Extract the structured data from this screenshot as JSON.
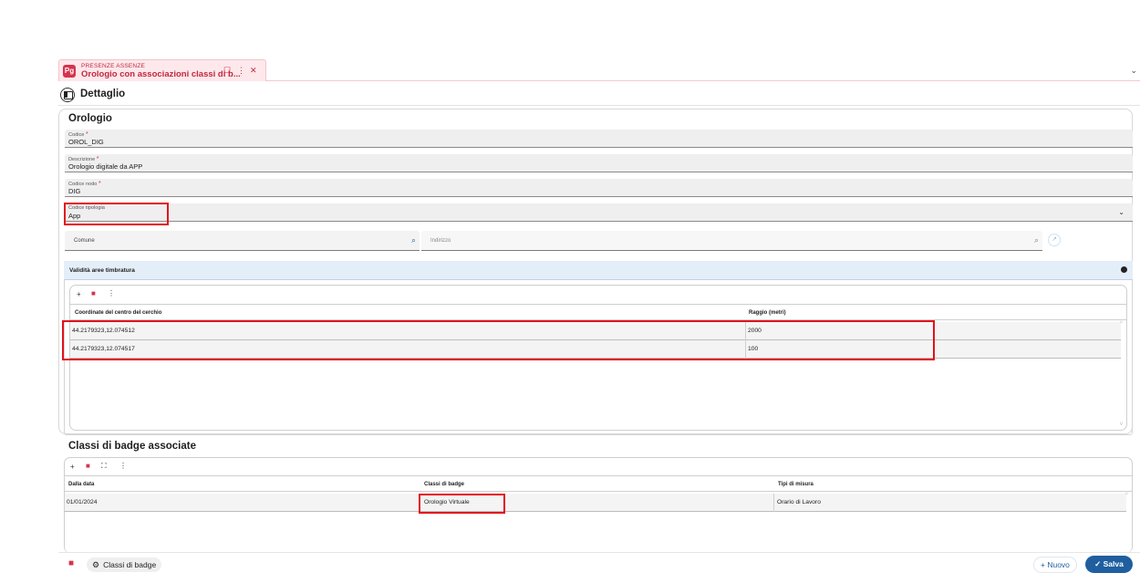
{
  "tab": {
    "app_logo": "Pg",
    "module": "PRESENZE ASSENZE",
    "title": "Orologio con associazioni classi di b...",
    "bookmark_icon": "bookmark-icon",
    "more_icon": "more-vert-icon",
    "close_icon": "close-icon"
  },
  "header": {
    "title": "Dettaglio"
  },
  "orologio": {
    "title": "Orologio",
    "fields": [
      {
        "label": "Codice",
        "required": "*",
        "value": "OROL_DIG"
      },
      {
        "label": "Descrizione",
        "required": "*",
        "value": "Orologio digitale da APP"
      },
      {
        "label": "Codice nodo",
        "required": "*",
        "value": "DIG"
      },
      {
        "label": "Codice tipologia",
        "required": "",
        "value": "App"
      }
    ],
    "comune_label": "Comune",
    "indirizzo_label": "Indirizzo"
  },
  "validita": {
    "title": "Validità aree timbratura",
    "columns": [
      "Coordinate del centro del cerchio",
      "Raggio (metri)"
    ],
    "rows": [
      [
        "44.2179323,12.074512",
        "2000"
      ],
      [
        "44.2179323,12.074517",
        "100"
      ]
    ]
  },
  "classi": {
    "title": "Classi di badge associate",
    "columns": [
      "Dalla data",
      "Classi di badge",
      "Tipi di misura"
    ],
    "rows": [
      [
        "01/01/2024",
        "Orologio Virtuale",
        "Orario di Lavoro"
      ]
    ]
  },
  "footer": {
    "classi_button": "Classi di badge",
    "nuovo_button": "Nuovo",
    "salva_button": "Salva"
  },
  "colors": {
    "accent_blue": "#1f5f9f",
    "brand_red": "#d6334c",
    "highlight_red": "#e3111b",
    "panel_header": "#e4eef8"
  }
}
